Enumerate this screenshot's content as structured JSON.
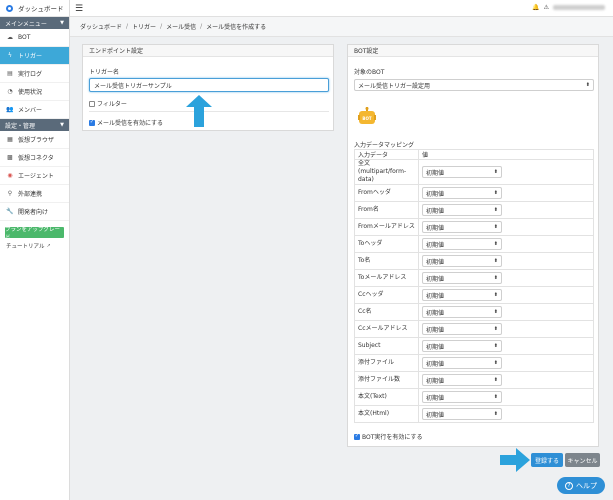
{
  "sidebar": {
    "brand": "ダッシュボード",
    "main_menu_title": "メインメニュー",
    "main_items": [
      {
        "label": "BOT",
        "icon": "cloud-icon"
      },
      {
        "label": "トリガー",
        "icon": "bolt-icon"
      },
      {
        "label": "実行ログ",
        "icon": "log-icon"
      },
      {
        "label": "使用状況",
        "icon": "chart-icon"
      },
      {
        "label": "メンバー",
        "icon": "users-icon"
      }
    ],
    "settings_title": "設定・管理",
    "settings_items": [
      {
        "label": "仮想ブラウザ",
        "icon": "browser-icon"
      },
      {
        "label": "仮想コネクタ",
        "icon": "connector-icon"
      },
      {
        "label": "エージェント",
        "icon": "agent-icon"
      },
      {
        "label": "外部連携",
        "icon": "link-icon"
      },
      {
        "label": "開発者向け",
        "icon": "wrench-icon"
      }
    ],
    "upgrade_label": "プランをアップグレード",
    "tutorial_label": "チュートリアル"
  },
  "breadcrumb": [
    "ダッシュボード",
    "トリガー",
    "メール受信",
    "メール受信を作成する"
  ],
  "endpoint_panel": {
    "title": "エンドポイント設定",
    "trigger_name_label": "トリガー名",
    "trigger_name_value": "メール受信トリガーサンプル",
    "filter_label": "フィルター",
    "enable_label": "メール受信を有効にする"
  },
  "bot_panel": {
    "title": "BOT設定",
    "target_label": "対象のBOT",
    "target_value": "メール受信トリガー設定用",
    "bot_badge": "BOT",
    "mapping_label": "入力データマッピング",
    "col_input": "入力データ",
    "col_value": "値",
    "rows": [
      {
        "name": "全文(multipart/form-data)",
        "value": "初期値"
      },
      {
        "name": "Fromヘッダ",
        "value": "初期値"
      },
      {
        "name": "From名",
        "value": "初期値"
      },
      {
        "name": "Fromメールアドレス",
        "value": "初期値"
      },
      {
        "name": "Toヘッダ",
        "value": "初期値"
      },
      {
        "name": "To名",
        "value": "初期値"
      },
      {
        "name": "Toメールアドレス",
        "value": "初期値"
      },
      {
        "name": "Ccヘッダ",
        "value": "初期値"
      },
      {
        "name": "Cc名",
        "value": "初期値"
      },
      {
        "name": "Ccメールアドレス",
        "value": "初期値"
      },
      {
        "name": "Subject",
        "value": "初期値"
      },
      {
        "name": "添付ファイル",
        "value": "初期値"
      },
      {
        "name": "添付ファイル数",
        "value": "初期値"
      },
      {
        "name": "本文(Text)",
        "value": "初期値"
      },
      {
        "name": "本文(Html)",
        "value": "初期値"
      }
    ],
    "enable_bot_label": "BOT実行を有効にする"
  },
  "actions": {
    "register_label": "登録する",
    "cancel_label": "キャンセル",
    "help_label": "ヘルプ"
  },
  "colors": {
    "accent": "#3da8d8",
    "primary_button": "#2e8fd6",
    "arrow": "#2ba2dc"
  }
}
